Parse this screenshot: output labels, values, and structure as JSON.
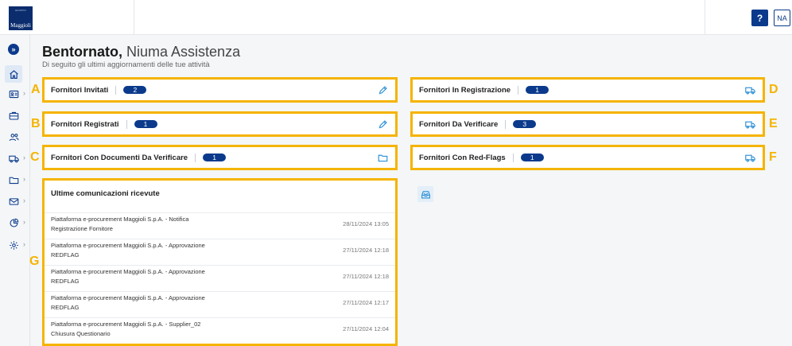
{
  "header": {
    "logo_top": "GRUPPO",
    "logo_name": "Maggioli",
    "help_label": "?",
    "user_initials": "NA"
  },
  "sidebar": {
    "toggle_icon": "double-chevron-right-icon",
    "items": [
      {
        "icon": "home-icon"
      },
      {
        "icon": "id-card-icon"
      },
      {
        "icon": "briefcase-icon"
      },
      {
        "icon": "users-icon"
      },
      {
        "icon": "truck-icon"
      },
      {
        "icon": "folder-icon"
      },
      {
        "icon": "mail-icon"
      },
      {
        "icon": "pie-chart-icon"
      },
      {
        "icon": "gear-icon"
      }
    ],
    "accent": "#0b3a8c"
  },
  "welcome": {
    "greeting": "Bentornato,",
    "name": "Niuma Assistenza",
    "subtitle": "Di seguito gli ultimi aggiornamenti delle tue attività"
  },
  "cards": [
    {
      "letter": "A",
      "title": "Fornitori Invitati",
      "count": "2",
      "icon": "pencil-icon"
    },
    {
      "letter": "B",
      "title": "Fornitori Registrati",
      "count": "1",
      "icon": "pencil-icon"
    },
    {
      "letter": "C",
      "title": "Fornitori Con Documenti Da Verificare",
      "count": "1",
      "icon": "folder-icon"
    },
    {
      "letter": "D",
      "title": "Fornitori In Registrazione",
      "count": "1",
      "icon": "truck-icon"
    },
    {
      "letter": "E",
      "title": "Fornitori Da Verificare",
      "count": "3",
      "icon": "truck-icon"
    },
    {
      "letter": "F",
      "title": "Fornitori Con Red-Flags",
      "count": "1",
      "icon": "truck-icon"
    }
  ],
  "messages": {
    "letter": "G",
    "title": "Ultime comunicazioni ricevute",
    "icon": "inbox-icon",
    "items": [
      {
        "line1": "Piattaforma e-procurement Maggioli S.p.A. - Notifica",
        "line2": "Registrazione Fornitore",
        "timestamp": "28/11/2024 13:05"
      },
      {
        "line1": "Piattaforma e-procurement Maggioli S.p.A. - Approvazione",
        "line2": "REDFLAG",
        "timestamp": "27/11/2024 12:18"
      },
      {
        "line1": "Piattaforma e-procurement Maggioli S.p.A. - Approvazione",
        "line2": "REDFLAG",
        "timestamp": "27/11/2024 12:18"
      },
      {
        "line1": "Piattaforma e-procurement Maggioli S.p.A. - Approvazione",
        "line2": "REDFLAG",
        "timestamp": "27/11/2024 12:17"
      },
      {
        "line1": "Piattaforma e-procurement Maggioli S.p.A. - Supplier_02",
        "line2": "Chiusura Questionario",
        "timestamp": "27/11/2024 12:04"
      }
    ]
  },
  "colors": {
    "highlight": "#f5b400",
    "badge": "#0b3a8c",
    "icon_accent": "#2a8fd6"
  }
}
